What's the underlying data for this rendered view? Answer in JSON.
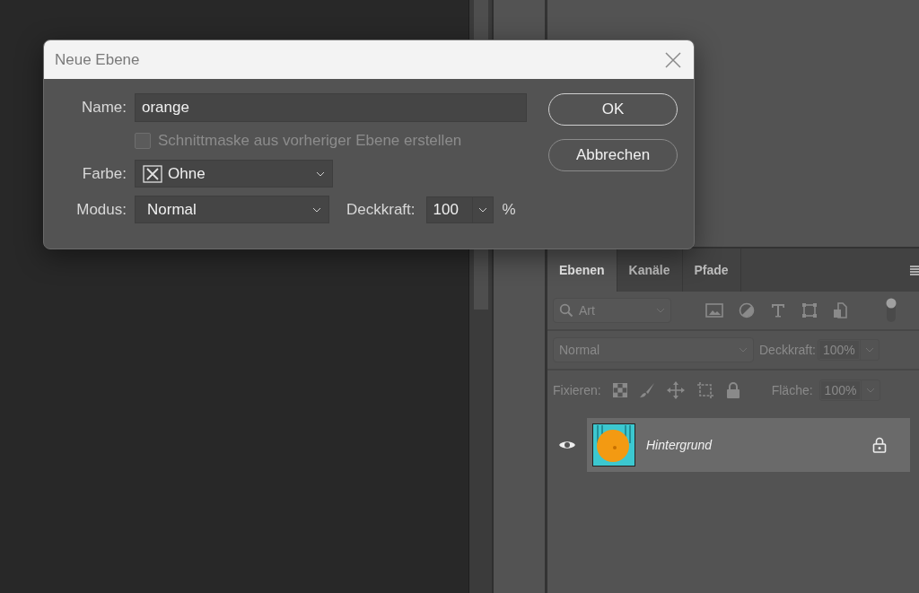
{
  "dialog": {
    "title": "Neue Ebene",
    "name_field": {
      "label": "Name:",
      "value": "orange"
    },
    "clipping_mask": {
      "label": "Schnittmaske aus vorheriger Ebene erstellen",
      "checked": false,
      "disabled": true
    },
    "color_field": {
      "label": "Farbe:",
      "value": "Ohne"
    },
    "mode_field": {
      "label": "Modus:",
      "value": "Normal"
    },
    "opacity_field": {
      "label": "Deckkraft:",
      "value": "100",
      "unit": "%"
    },
    "buttons": [
      "OK",
      "Abbrechen"
    ]
  },
  "layers_panel": {
    "tabs": [
      {
        "label": "Ebenen",
        "selected": true
      },
      {
        "label": "Kanäle",
        "selected": false
      },
      {
        "label": "Pfade",
        "selected": false
      }
    ],
    "filter": {
      "placeholder": "Art"
    },
    "blend_mode": {
      "value": "Normal"
    },
    "opacity": {
      "label": "Deckkraft:",
      "value": "100%"
    },
    "lock_label": "Fixieren:",
    "fill": {
      "label": "Fläche:",
      "value": "100%"
    },
    "layers": [
      {
        "name": "Hintergrund",
        "visible": true,
        "locked": true,
        "selected": true
      }
    ]
  }
}
